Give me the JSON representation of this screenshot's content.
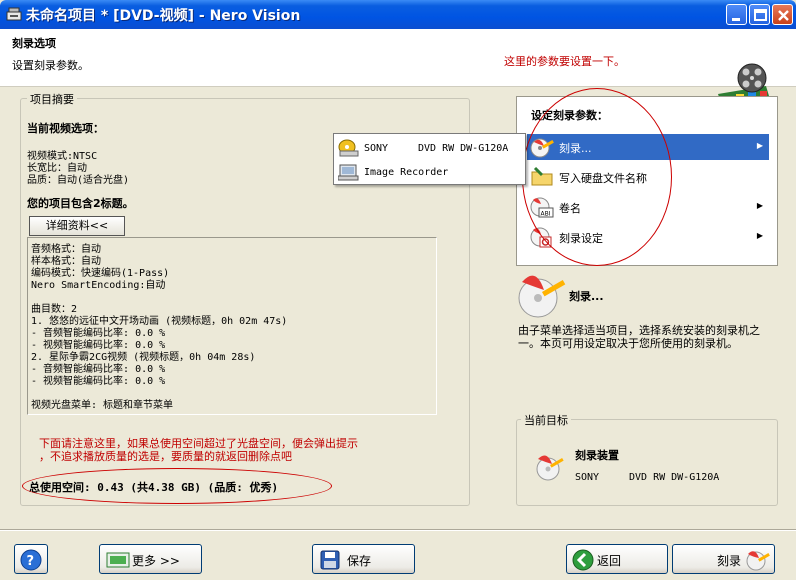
{
  "window": {
    "title": "未命名项目 * [DVD-视频] - Nero Vision",
    "minimize": "minimize",
    "maximize": "maximize",
    "close": "close"
  },
  "header": {
    "title": "刻录选项",
    "subtitle": "设置刻录参数。",
    "annotation": "这里的参数要设置一下。"
  },
  "summary": {
    "legend": "项目摘要",
    "video_options_heading": "当前视频选项：",
    "video_mode": "视频模式:NTSC",
    "aspect_ratio": "长宽比：自动",
    "quality": "品质：自动(适合光盘)",
    "titles_count": "您的项目包含2标题。",
    "detail_button": "详细资料<<",
    "details": [
      "音频格式：自动",
      "样本格式：自动",
      "编码模式：快速编码(1-Pass)",
      "Nero SmartEncoding:自动",
      "",
      "曲目数：2",
      "1. 悠悠的远征中文开场动画 (视频标题，0h 02m 47s)",
      "- 音频智能编码比率: 0.0 %",
      "- 视频智能编码比率: 0.0 %",
      "2. 星际争霸2CG视频 (视频标题，0h 04m 28s)",
      "- 音频智能编码比率: 0.0 %",
      "- 视频智能编码比率: 0.0 %",
      "",
      "视频光盘菜单: 标题和章节菜单"
    ],
    "warning_line1": "下面请注意这里，如果总使用空间超过了光盘空间，便会弹出提示",
    "warning_line2": "，不追求播放质量的选是，要质量的就返回删除点吧",
    "total_space": "总使用空间: 0.43 (共4.38 GB) (品质: 优秀)"
  },
  "burn_menu": {
    "title": "设定刻录参数：",
    "items": [
      {
        "label": "刻录...",
        "icon": "burn-icon",
        "has_submenu": true,
        "selected": true
      },
      {
        "label": "写入硬盘文件名称",
        "icon": "folder-icon",
        "has_submenu": false,
        "selected": false
      },
      {
        "label": "卷名",
        "icon": "volume-label-icon",
        "has_submenu": true,
        "selected": false
      },
      {
        "label": "刻录设定",
        "icon": "burn-settings-icon",
        "has_submenu": true,
        "selected": false
      }
    ],
    "submenu_arrow": "▶"
  },
  "recorder_popup": {
    "items": [
      {
        "name": "SONY",
        "model": "DVD RW DW-G120A",
        "icon": "disc-drive-icon"
      },
      {
        "name": "Image Recorder",
        "model": "",
        "icon": "image-recorder-icon"
      }
    ]
  },
  "burn_info": {
    "heading": "刻录...",
    "description": "由子菜单选择适当项目，选择系统安装的刻录机之一。本页可用设定取决于您所使用的刻录机。"
  },
  "current_target": {
    "legend": "当前目标",
    "label": "刻录装置",
    "device_name": "SONY",
    "device_model": "DVD RW DW-G120A"
  },
  "footer": {
    "help": "?",
    "more": "更多 >>",
    "save": "保存",
    "back": "返回",
    "burn": "刻录"
  },
  "colors": {
    "title_bar": "#0054e3",
    "selection": "#316ac5",
    "annotation_red": "#c00000",
    "window_bg": "#ece9d8"
  }
}
